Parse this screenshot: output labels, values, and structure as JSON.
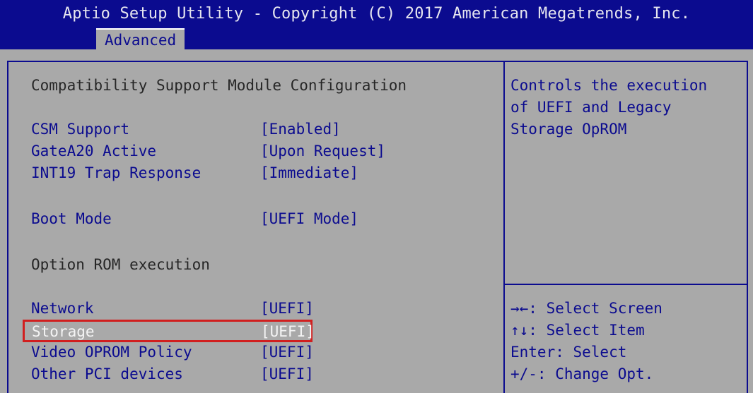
{
  "header": {
    "title": "Aptio Setup Utility - Copyright (C) 2017 American Megatrends, Inc.",
    "tab": "Advanced"
  },
  "main": {
    "section_title": "Compatibility Support Module Configuration",
    "items": [
      {
        "label": "CSM Support",
        "value": "[Enabled]"
      },
      {
        "label": "GateA20 Active",
        "value": "[Upon Request]"
      },
      {
        "label": "INT19 Trap Response",
        "value": "[Immediate]"
      },
      {
        "label": "Boot Mode",
        "value": "[UEFI Mode]"
      },
      {
        "label": "Network",
        "value": "[UEFI]"
      },
      {
        "label": "Storage",
        "value": "[UEFI]"
      },
      {
        "label": "Video OPROM Policy",
        "value": "[UEFI]"
      },
      {
        "label": "Other PCI devices",
        "value": "[UEFI]"
      }
    ],
    "subsection_title": "Option ROM execution"
  },
  "help": {
    "line1": "Controls the execution",
    "line2": "of UEFI and Legacy",
    "line3": "Storage OpROM"
  },
  "keys": [
    "→←: Select Screen",
    "↑↓: Select Item",
    "Enter: Select",
    "+/-: Change Opt."
  ],
  "colors": {
    "header_background": "#0b0b8f",
    "content_background": "#a9a9a9",
    "selection_outline": "#d11f1f"
  }
}
